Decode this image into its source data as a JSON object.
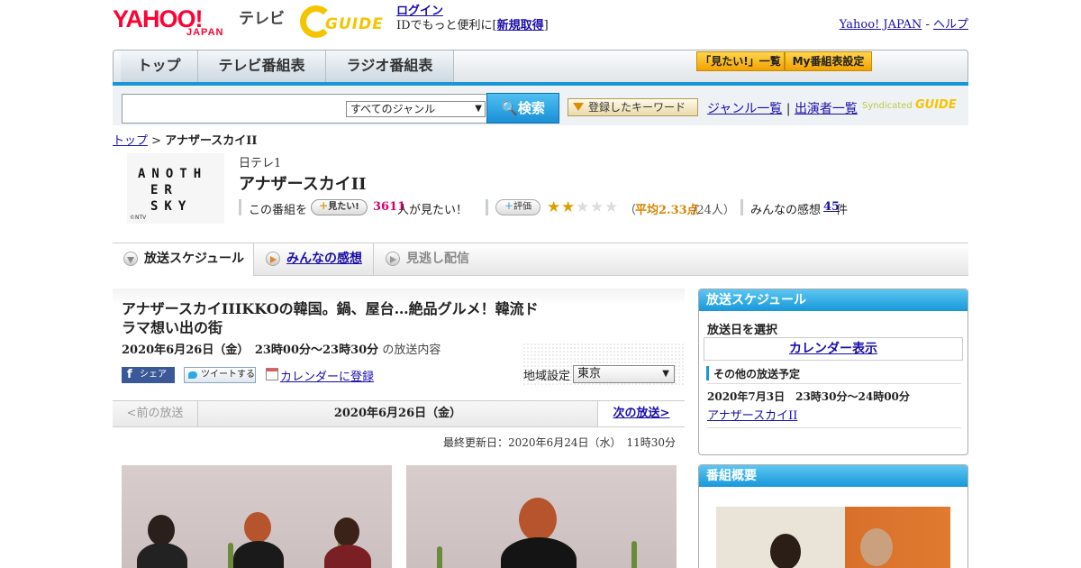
{
  "header": {
    "logo_text": "YAHOO!",
    "logo_sub": "JAPAN",
    "tv_label": "テレビ",
    "gguide_text": "GUIDE",
    "login_label": "ログイン",
    "id_prefix": "IDでもっと便利に[",
    "signup_label": "新規取得",
    "id_suffix": "]",
    "yahoo_japan_link": "Yahoo! JAPAN",
    "separator": "-",
    "help_link": "ヘルプ"
  },
  "nav": {
    "tabs": [
      "トップ",
      "テレビ番組表",
      "ラジオ番組表"
    ],
    "mitai_list": "「見たい!」一覧",
    "my_schedule": "My番組表設定"
  },
  "search": {
    "genre_selected": "すべてのジャンル",
    "search_button": "検索",
    "keyword_button": "登録したキーワード",
    "genre_list": "ジャンル一覧",
    "divider": "|",
    "performer_list": "出演者一覧",
    "syndicated": "Syndicated",
    "syndicated_logo": "GUIDE"
  },
  "breadcrumb": {
    "top": "トップ",
    "sep": ">",
    "current": "アナザースカイII"
  },
  "program": {
    "logo_lines": [
      "ANOTH",
      "ER",
      "SKY"
    ],
    "logo_credit": "©NTV",
    "channel": "日テレ1",
    "title": "アナザースカイII",
    "mitai_prefix": "この番組を",
    "mitai_button": "見たい!",
    "mitai_count": "3611",
    "mitai_suffix": "人が見たい！",
    "rate_button": "評価",
    "rating": 2.33,
    "rating_prefix": "（",
    "rating_avg": "平均2.33点",
    "rating_votes": "/24人）",
    "impressions_label": "みんなの感想",
    "impressions_count": "45",
    "impressions_unit": "件"
  },
  "tabs": {
    "schedule": "放送スケジュール",
    "impressions": "みんなの感想",
    "streaming": "見逃し配信"
  },
  "episode": {
    "title": "アナザースカイIIIKKOの韓国。鍋、屋台…絶品グルメ！韓流ドラマ想い出の街",
    "datetime": "2020年6月26日（金）　23時00分～23時30分",
    "datetime_suffix": "の放送内容",
    "share": "シェア",
    "tweet": "ツイートする",
    "calendar": "カレンダーに登録",
    "region_label": "地域設定",
    "region_value": "東京"
  },
  "date_nav": {
    "prev": "<前の放送",
    "current": "2020年6月26日（金）",
    "next": "次の放送>"
  },
  "updated": "最終更新日：2020年6月24日（水）　11時30分",
  "sidebar": {
    "schedule_header": "放送スケジュール",
    "select_date": "放送日を選択",
    "calendar_link": "カレンダー表示",
    "other_header": "その他の放送予定",
    "other_datetime": "2020年7月3日　23時30分～24時00分",
    "other_title": "アナザースカイII",
    "overview_header": "番組概要"
  },
  "colors": {
    "accent_blue": "#1898da",
    "yahoo_red": "#ff0033",
    "guide_yellow": "#f5c400",
    "count_pink": "#d6006e",
    "rating_orange": "#d98500"
  }
}
